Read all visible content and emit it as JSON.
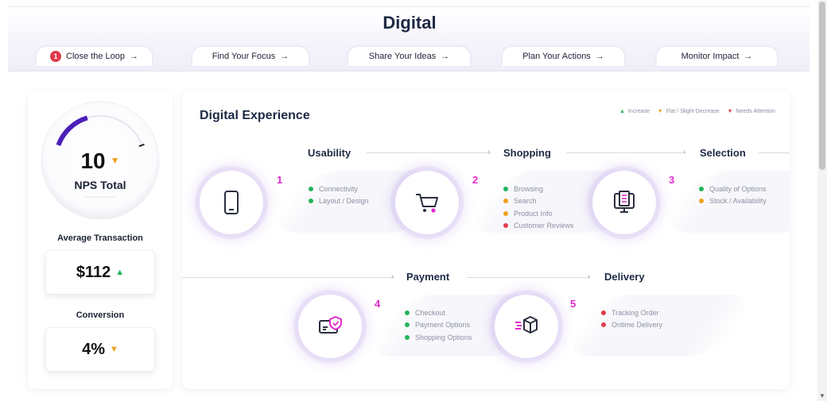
{
  "page_title": "Digital",
  "tabs": [
    {
      "label": "Close the Loop",
      "badge": "1"
    },
    {
      "label": "Find Your Focus"
    },
    {
      "label": "Share Your Ideas"
    },
    {
      "label": "Plan Your Actions"
    },
    {
      "label": "Monitor Impact"
    }
  ],
  "tab_arrow": "→",
  "summary": {
    "nps_value": "10",
    "nps_label": "NPS Total",
    "nps_trend": "flat",
    "gauge_fill_fraction": 0.38,
    "avg_transaction_label": "Average Transaction",
    "avg_transaction_value": "$112",
    "avg_transaction_trend": "increase",
    "conversion_label": "Conversion",
    "conversion_value": "4%",
    "conversion_trend": "flat"
  },
  "main": {
    "title": "Digital Experience",
    "legend": [
      {
        "label": "Increase",
        "color": "#22b45a",
        "symbol": "▲"
      },
      {
        "label": "Flat / Slight Decrease",
        "color": "#f0a020",
        "symbol": "▼"
      },
      {
        "label": "Needs Attention",
        "color": "#e23d4b",
        "symbol": "▼"
      }
    ],
    "stages": [
      {
        "num": "1",
        "title": "Usability",
        "icon": "phone-icon",
        "items": [
          {
            "label": "Connectivity",
            "status": "green"
          },
          {
            "label": "Layout / Design",
            "status": "green"
          }
        ]
      },
      {
        "num": "2",
        "title": "Shopping",
        "icon": "cart-icon",
        "items": [
          {
            "label": "Browsing",
            "status": "green"
          },
          {
            "label": "Search",
            "status": "orange"
          },
          {
            "label": "Product Info",
            "status": "orange"
          },
          {
            "label": "Customer Reviews",
            "status": "red"
          }
        ]
      },
      {
        "num": "3",
        "title": "Selection",
        "icon": "catalog-icon",
        "items": [
          {
            "label": "Quality of Options",
            "status": "green"
          },
          {
            "label": "Stock / Availability",
            "status": "orange"
          }
        ]
      },
      {
        "num": "4",
        "title": "Payment",
        "icon": "secure-payment-icon",
        "items": [
          {
            "label": "Checkout",
            "status": "green"
          },
          {
            "label": "Payment Options",
            "status": "green"
          },
          {
            "label": "Shopping Options",
            "status": "green"
          }
        ]
      },
      {
        "num": "5",
        "title": "Delivery",
        "icon": "delivery-box-icon",
        "items": [
          {
            "label": "Tracking Order",
            "status": "red"
          },
          {
            "label": "Ontime Delivery",
            "status": "red"
          }
        ]
      }
    ]
  },
  "colors": {
    "green": "#22b45a",
    "orange": "#f0a020",
    "red": "#e23d4b",
    "accent": "#4b1fb8",
    "number": "#e02aca"
  }
}
